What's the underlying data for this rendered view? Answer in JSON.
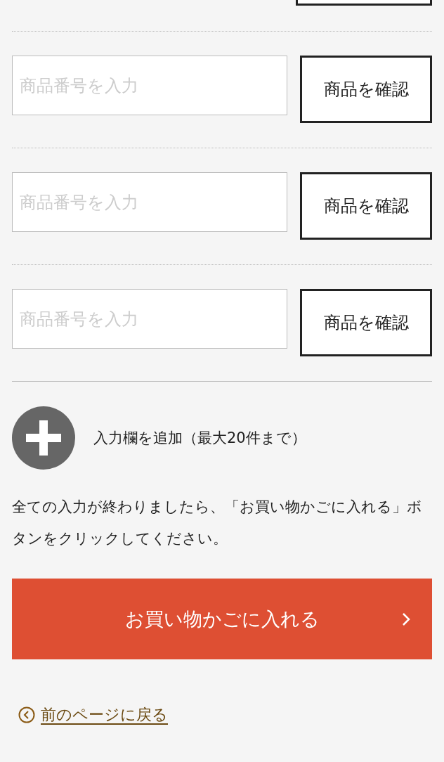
{
  "rows": [
    {
      "placeholder": "商品番号を入力",
      "button": "商品を確認"
    },
    {
      "placeholder": "商品番号を入力",
      "button": "商品を確認"
    },
    {
      "placeholder": "商品番号を入力",
      "button": "商品を確認"
    }
  ],
  "add": {
    "label": "入力欄を追加（最大20件まで）"
  },
  "note": "全ての入力が終わりましたら、「お買い物かごに入れる」ボタンをクリックしてください。",
  "cart_button": {
    "label": "お買い物かごに入れる"
  },
  "back_link": {
    "label": "前のページに戻る"
  }
}
